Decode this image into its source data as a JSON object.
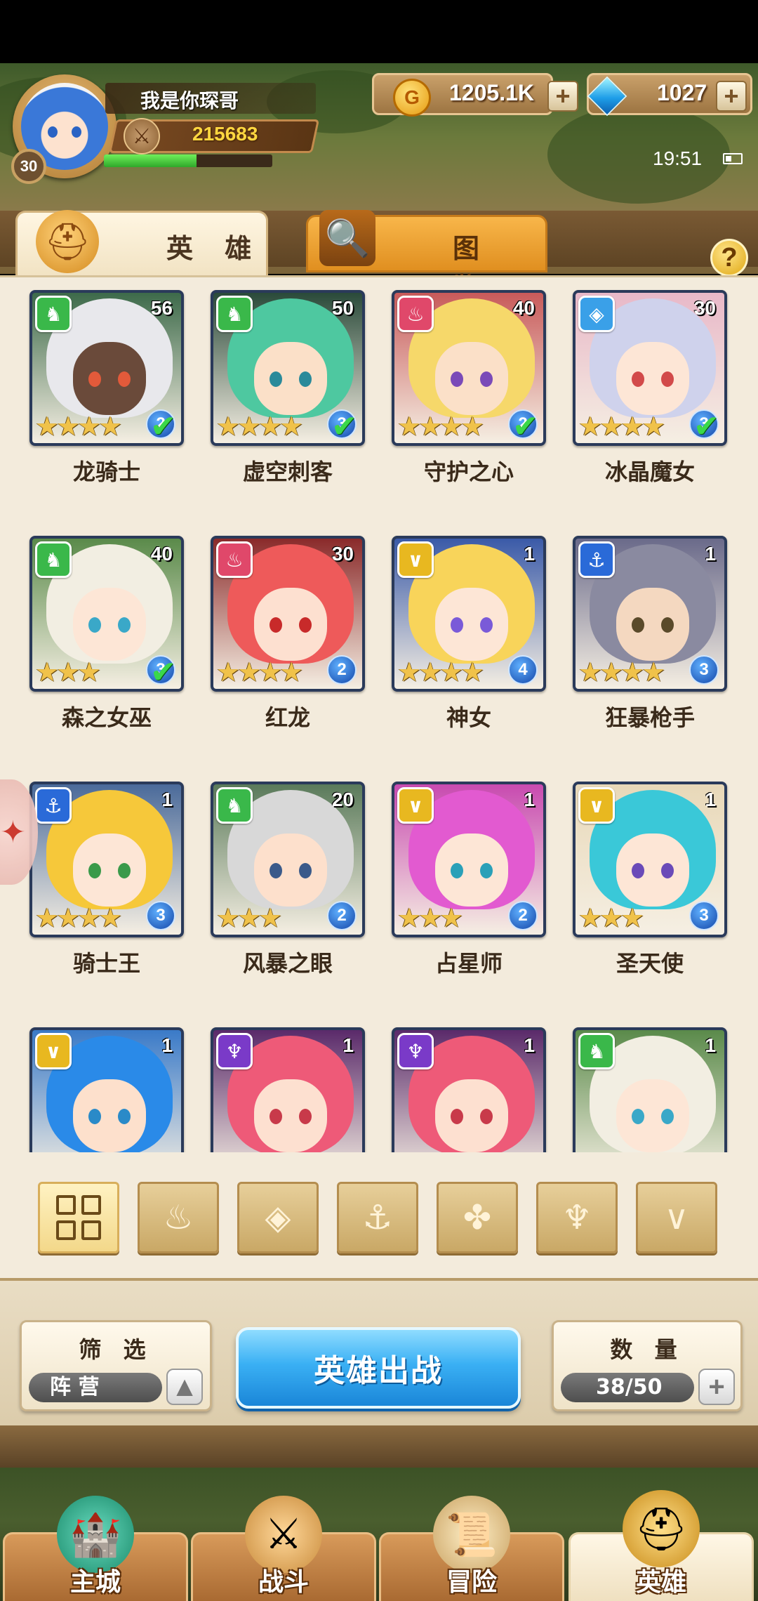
{
  "player": {
    "name": "我是你琛哥",
    "level": "30",
    "power": "215683",
    "exp_fraction": 0.55
  },
  "currency": {
    "gold": "1205.1K",
    "gems": "1027"
  },
  "status": {
    "time": "19:51"
  },
  "tabs": {
    "heroes": "英 雄",
    "codex": "图 鉴"
  },
  "help_label": "?",
  "heroes": [
    {
      "name": "龙骑士",
      "level": "56",
      "stars": 4,
      "grade": "2",
      "check": true,
      "faction": "beast",
      "hair": "#e8e8ec",
      "skin": "#6a4a3a",
      "eye": "#e25a3a",
      "bg": "#3d6a4a"
    },
    {
      "name": "虚空刺客",
      "level": "50",
      "stars": 4,
      "grade": "3",
      "check": true,
      "faction": "beast",
      "hair": "#4ec8a0",
      "skin": "#fbe0c8",
      "eye": "#2a8a9a",
      "bg": "#2a4a3a"
    },
    {
      "name": "守护之心",
      "level": "40",
      "stars": 4,
      "grade": "2",
      "check": true,
      "faction": "fire",
      "hair": "#f6d86a",
      "skin": "#fbe0c8",
      "eye": "#7a4ab8",
      "bg": "#c85a5a"
    },
    {
      "name": "冰晶魔女",
      "level": "30",
      "stars": 4,
      "grade": "3",
      "check": true,
      "faction": "ice",
      "hair": "#cfd2ec",
      "skin": "#fde6d6",
      "eye": "#d24a4a",
      "bg": "#e8b8c8"
    },
    {
      "name": "森之女巫",
      "level": "40",
      "stars": 3,
      "grade": "3",
      "check": true,
      "faction": "beast",
      "hair": "#f2eee2",
      "skin": "#fde6d6",
      "eye": "#3aa8c8",
      "bg": "#5a8a4a"
    },
    {
      "name": "红龙",
      "level": "30",
      "stars": 4,
      "grade": "2",
      "check": false,
      "faction": "fire",
      "hair": "#ee5a5a",
      "skin": "#fde0d0",
      "eye": "#c82a2a",
      "bg": "#8a2a2a"
    },
    {
      "name": "神女",
      "level": "1",
      "stars": 4,
      "grade": "4",
      "check": false,
      "faction": "light",
      "hair": "#f8d45a",
      "skin": "#fde6d6",
      "eye": "#7a5ad8",
      "bg": "#3a5aa8"
    },
    {
      "name": "狂暴枪手",
      "level": "1",
      "stars": 4,
      "grade": "3",
      "check": false,
      "faction": "anchor",
      "hair": "#8a8aa0",
      "skin": "#f4d8c0",
      "eye": "#5a4a2a",
      "bg": "#6a6a8a"
    },
    {
      "name": "骑士王",
      "level": "1",
      "stars": 4,
      "grade": "3",
      "check": false,
      "faction": "anchor",
      "hair": "#f6c83a",
      "skin": "#fde6d6",
      "eye": "#3a9a4a",
      "bg": "#4a6a9a"
    },
    {
      "name": "风暴之眼",
      "level": "20",
      "stars": 3,
      "grade": "2",
      "check": false,
      "faction": "beast",
      "hair": "#d8d8d8",
      "skin": "#fde0cc",
      "eye": "#3a5a8a",
      "bg": "#5a7a5a"
    },
    {
      "name": "占星师",
      "level": "1",
      "stars": 3,
      "grade": "2",
      "check": false,
      "faction": "light",
      "hair": "#e25ad0",
      "skin": "#fde6d6",
      "eye": "#2aa0b8",
      "bg": "#c84ab0"
    },
    {
      "name": "圣天使",
      "level": "1",
      "stars": 3,
      "grade": "3",
      "check": false,
      "faction": "light",
      "hair": "#3ac8d8",
      "skin": "#fde6d6",
      "eye": "#6a4ab8",
      "bg": "#e8d8b8"
    },
    {
      "name": "",
      "level": "1",
      "stars": 0,
      "grade": "",
      "check": false,
      "faction": "light",
      "hair": "#2a8ae8",
      "skin": "#fde0cc",
      "eye": "#2a8ac8",
      "bg": "#3a7ac8"
    },
    {
      "name": "",
      "level": "1",
      "stars": 0,
      "grade": "",
      "check": false,
      "faction": "dark",
      "hair": "#ee5a78",
      "skin": "#fde0d0",
      "eye": "#c83a4a",
      "bg": "#5a2a6a"
    },
    {
      "name": "",
      "level": "1",
      "stars": 0,
      "grade": "",
      "check": false,
      "faction": "dark",
      "hair": "#ee5a78",
      "skin": "#fde0d0",
      "eye": "#c83a4a",
      "bg": "#5a2a6a"
    },
    {
      "name": "",
      "level": "1",
      "stars": 0,
      "grade": "",
      "check": false,
      "faction": "beast",
      "hair": "#f2eee2",
      "skin": "#fde6d6",
      "eye": "#3aa8c8",
      "bg": "#5a8a4a"
    }
  ],
  "faction_colors": {
    "beast": "#3ab84a",
    "fire": "#e0486a",
    "ice": "#3aa0e8",
    "light": "#e8b820",
    "anchor": "#2a6ad8",
    "dark": "#7a3ac8"
  },
  "faction_icons": [
    "grid-icon",
    "fire-faction-icon",
    "ice-faction-icon",
    "anchor-faction-icon",
    "beast-faction-icon",
    "dark-faction-icon",
    "light-faction-icon"
  ],
  "filter": {
    "title": "筛 选",
    "value": "阵 营"
  },
  "deploy_label": "英雄出战",
  "count": {
    "title": "数 量",
    "value": "38/50"
  },
  "nav": [
    {
      "label": "主城"
    },
    {
      "label": "战斗"
    },
    {
      "label": "冒险"
    },
    {
      "label": "英雄"
    }
  ]
}
